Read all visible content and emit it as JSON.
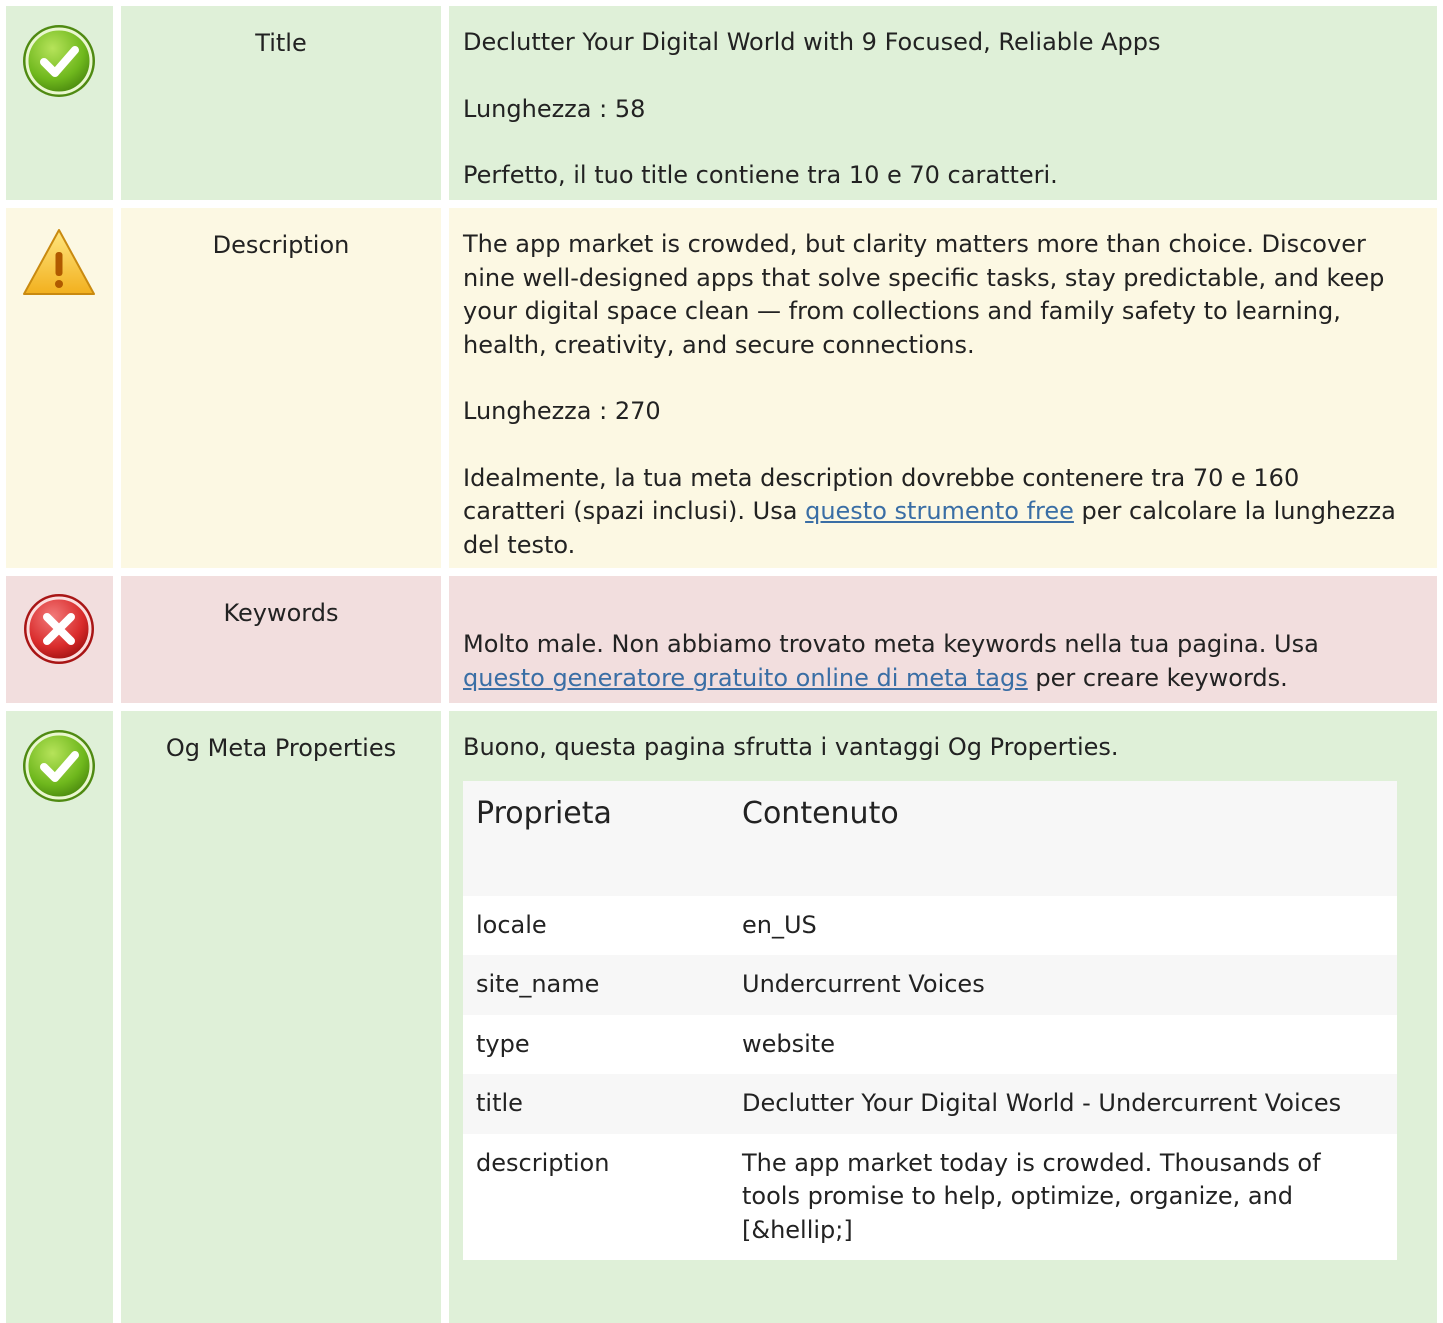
{
  "rows": {
    "title": {
      "label": "Title",
      "status": "ok",
      "value": "Declutter Your Digital World with 9 Focused, Reliable Apps",
      "length": "Lunghezza : 58",
      "message": "Perfetto, il tuo title contiene tra 10 e 70 caratteri."
    },
    "description": {
      "label": "Description",
      "status": "warning",
      "value": "The app market is crowded, but clarity matters more than choice. Discover nine well-designed apps that solve specific tasks, stay predictable, and keep your digital space clean — from collections and family safety to learning, health, creativity, and secure connections.",
      "length": "Lunghezza : 270",
      "message_before": "Idealmente, la tua meta description dovrebbe contenere tra 70 e 160 caratteri (spazi inclusi). Usa ",
      "message_link": "questo strumento free",
      "message_after": " per calcolare la lunghezza del testo."
    },
    "keywords": {
      "label": "Keywords",
      "status": "error",
      "message_before": "Molto male. Non abbiamo trovato meta keywords nella tua pagina. Usa ",
      "message_link": "questo generatore gratuito online di meta tags",
      "message_after": " per creare keywords."
    },
    "og": {
      "label": "Og Meta Properties",
      "status": "ok",
      "message": "Buono, questa pagina sfrutta i vantaggi Og Properties.",
      "table": {
        "header_property": "Proprieta",
        "header_content": "Contenuto",
        "rows": [
          {
            "property": "locale",
            "content": "en_US"
          },
          {
            "property": "site_name",
            "content": "Undercurrent Voices"
          },
          {
            "property": "type",
            "content": "website"
          },
          {
            "property": "title",
            "content": "Declutter Your Digital World - Undercurrent Voices"
          },
          {
            "property": "description",
            "content": "The app market today is crowded. Thousands of tools promise to help, optimize, organize, and [&hellip;]"
          }
        ]
      }
    }
  },
  "colors": {
    "ok_bg": "#dff0d8",
    "warning_bg": "#fcf8e3",
    "error_bg": "#f2dede",
    "link": "#3a6ea5"
  },
  "icons": {
    "ok": "check-circle-icon",
    "warning": "warning-triangle-icon",
    "error": "error-x-circle-icon"
  }
}
